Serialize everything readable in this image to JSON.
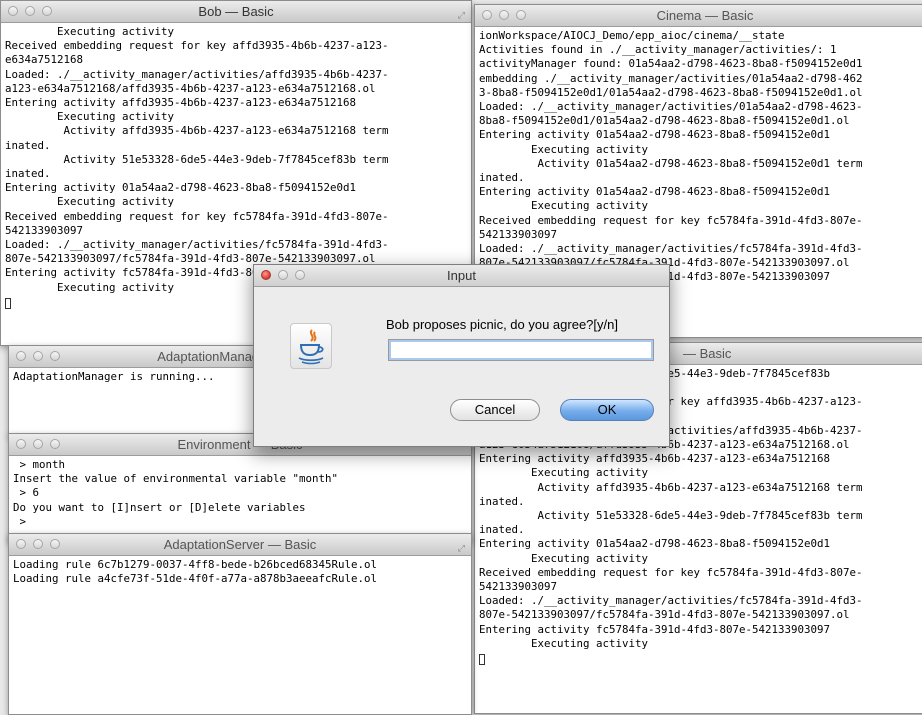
{
  "windows": {
    "bob": {
      "title": "Bob — Basic",
      "lines": [
        "        Executing activity",
        "Received embedding request for key affd3935-4b6b-4237-a123-",
        "e634a7512168",
        "Loaded: ./__activity_manager/activities/affd3935-4b6b-4237-",
        "a123-e634a7512168/affd3935-4b6b-4237-a123-e634a7512168.ol",
        "Entering activity affd3935-4b6b-4237-a123-e634a7512168",
        "        Executing activity",
        "         Activity affd3935-4b6b-4237-a123-e634a7512168 term",
        "inated.",
        "         Activity 51e53328-6de5-44e3-9deb-7f7845cef83b term",
        "inated.",
        "Entering activity 01a54aa2-d798-4623-8ba8-f5094152e0d1",
        "        Executing activity",
        "Received embedding request for key fc5784fa-391d-4fd3-807e-",
        "542133903097",
        "Loaded: ./__activity_manager/activities/fc5784fa-391d-4fd3-",
        "807e-542133903097/fc5784fa-391d-4fd3-807e-542133903097.ol",
        "Entering activity fc5784fa-391d-4fd3-807e-542133903097",
        "        Executing activity"
      ]
    },
    "cinema": {
      "title": "Cinema — Basic",
      "lines": [
        "ionWorkspace/AIOCJ_Demo/epp_aioc/cinema/__state",
        "Activities found in ./__activity_manager/activities/: 1",
        "activityManager found: 01a54aa2-d798-4623-8ba8-f5094152e0d1",
        "embedding ./__activity_manager/activities/01a54aa2-d798-462",
        "3-8ba8-f5094152e0d1/01a54aa2-d798-4623-8ba8-f5094152e0d1.ol",
        "Loaded: ./__activity_manager/activities/01a54aa2-d798-4623-",
        "8ba8-f5094152e0d1/01a54aa2-d798-4623-8ba8-f5094152e0d1.ol",
        "Entering activity 01a54aa2-d798-4623-8ba8-f5094152e0d1",
        "        Executing activity",
        "         Activity 01a54aa2-d798-4623-8ba8-f5094152e0d1 term",
        "inated.",
        "Entering activity 01a54aa2-d798-4623-8ba8-f5094152e0d1",
        "        Executing activity",
        "Received embedding request for key fc5784fa-391d-4fd3-807e-",
        "542133903097",
        "Loaded: ./__activity_manager/activities/fc5784fa-391d-4fd3-",
        "807e-542133903097/fc5784fa-391d-4fd3-807e-542133903097.ol",
        "Entering activity fc5784fa-391d-4fd3-807e-542133903097"
      ]
    },
    "adaptation_manager": {
      "title": "AdaptationManager — Basic",
      "lines": [
        "AdaptationManager is running..."
      ]
    },
    "environment": {
      "title": "Environment — Basic",
      "lines": [
        " > month",
        "Insert the value of environmental variable \"month\"",
        " > 6",
        "Do you want to [I]nsert or [D]elete variables",
        " >"
      ]
    },
    "adaptation_server": {
      "title": "AdaptationServer — Basic",
      "lines": [
        "Loading rule 6c7b1279-0037-4ff8-bede-b26bced68345Rule.ol",
        "Loading rule a4cfe73f-51de-4f0f-a77a-a878b3aeeafcRule.ol"
      ]
    },
    "third": {
      "title": "— Basic",
      "lines": [
        "         Activity 51e53328-6de5-44e3-9deb-7f7845cef83b",
        "",
        "Received embedding request for key affd3935-4b6b-4237-a123-",
        "",
        "Loaded: ./__activity_manager/activities/affd3935-4b6b-4237-",
        "a123-e634a7512168/affd3935-4b6b-4237-a123-e634a7512168.ol",
        "Entering activity affd3935-4b6b-4237-a123-e634a7512168",
        "        Executing activity",
        "         Activity affd3935-4b6b-4237-a123-e634a7512168 term",
        "inated.",
        "         Activity 51e53328-6de5-44e3-9deb-7f7845cef83b term",
        "inated.",
        "Entering activity 01a54aa2-d798-4623-8ba8-f5094152e0d1",
        "        Executing activity",
        "Received embedding request for key fc5784fa-391d-4fd3-807e-",
        "542133903097",
        "Loaded: ./__activity_manager/activities/fc5784fa-391d-4fd3-",
        "807e-542133903097/fc5784fa-391d-4fd3-807e-542133903097.ol",
        "Entering activity fc5784fa-391d-4fd3-807e-542133903097",
        "        Executing activity"
      ]
    }
  },
  "dialog": {
    "title": "Input",
    "prompt": "Bob proposes picnic, do you agree?[y/n]",
    "input_value": "",
    "cancel_label": "Cancel",
    "ok_label": "OK",
    "icon": "java-coffee-cup-icon"
  },
  "colors": {
    "ok_button": "#6aa6ea",
    "close_light": "#e0443a",
    "minimize_light": "#f3b734",
    "zoom_light": "#5fc23a"
  }
}
